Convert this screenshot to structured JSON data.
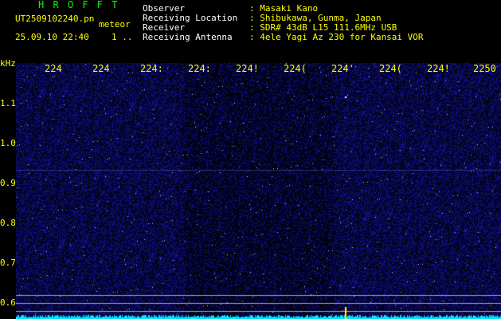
{
  "header": {
    "app_title": "H R O F F T",
    "file_name": "UT2509102240.pn",
    "mode": "meteor",
    "datetime": "25.09.10 22:40",
    "counter": "1 ..",
    "fields": [
      {
        "label": "Observer",
        "value": ": Masaki Kano"
      },
      {
        "label": "Receiving Location",
        "value": ": Shibukawa, Gunma, Japan"
      },
      {
        "label": "Receiver",
        "value": ": SDR# 43dB L15 111.6MHz USB"
      },
      {
        "label": "Receiving Antenna",
        "value": ": 4ele Yagi Az 230 for Kansai VOR"
      }
    ]
  },
  "axes": {
    "y_unit": "kHz",
    "y_ticks": [
      "1.1",
      "1.0",
      "0.9",
      "0.8",
      "0.7",
      "0.6"
    ],
    "x_ticks": [
      "224",
      "224",
      "224:",
      "224:",
      "224!",
      "224(",
      "224'",
      "224(",
      "224!",
      "2250"
    ]
  },
  "colors": {
    "background": "#000000",
    "noise": "#1a1aa8",
    "signal": "#ffffff",
    "baseline": "#00e5ff",
    "labels": "#ffff00",
    "title": "#00ff00"
  }
}
